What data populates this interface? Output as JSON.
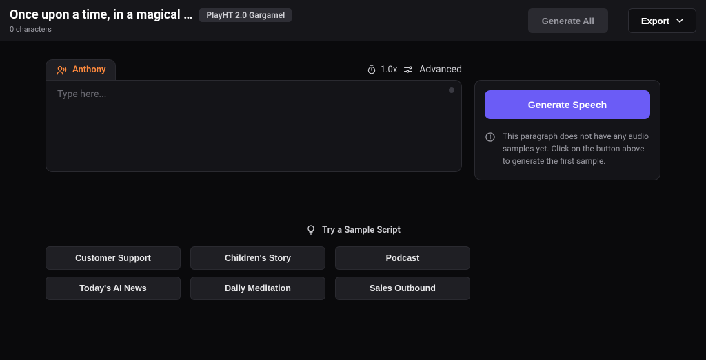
{
  "header": {
    "title": "Once upon a time, in a magical …",
    "model_badge": "PlayHT 2.0 Gargamel",
    "char_count": "0 characters",
    "generate_all": "Generate All",
    "export": "Export"
  },
  "editor": {
    "voice_name": "Anthony",
    "speed": "1.0x",
    "advanced_label": "Advanced",
    "placeholder": "Type here..."
  },
  "right": {
    "generate_speech": "Generate Speech",
    "info_text": "This paragraph does not have any audio samples yet. Click on the button above to generate the first sample."
  },
  "samples": {
    "heading": "Try a Sample Script",
    "items": [
      "Customer Support",
      "Children's Story",
      "Podcast",
      "Today's AI News",
      "Daily Meditation",
      "Sales Outbound"
    ]
  }
}
